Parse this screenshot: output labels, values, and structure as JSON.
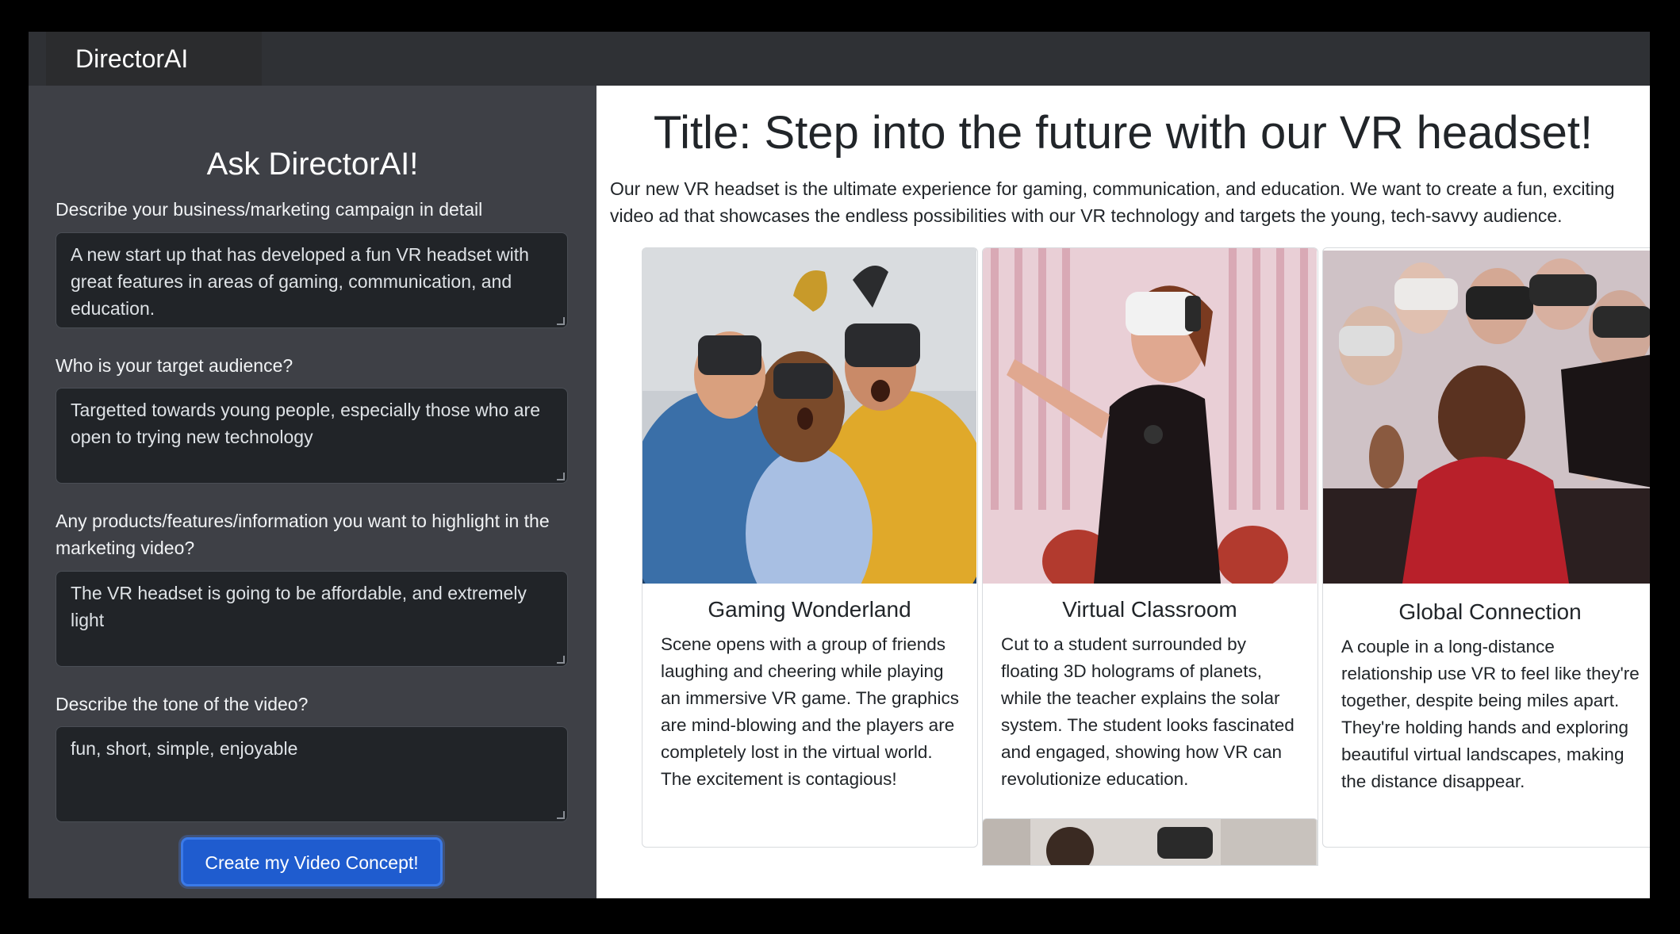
{
  "navbar": {
    "brand": "DirectorAI"
  },
  "sidebar": {
    "title": "Ask DirectorAI!",
    "fields": [
      {
        "label": "Describe your business/marketing campaign in detail",
        "value": "A new start up that has developed a fun VR headset with great features in areas of gaming, communication, and education."
      },
      {
        "label": "Who is your target audience?",
        "value": "Targetted towards young people, especially those who are open to trying new technology"
      },
      {
        "label": "Any products/features/information you want to highlight in the marketing video?",
        "value": "The VR headset is going to be affordable, and extremely light"
      },
      {
        "label": "Describe the tone of the video?",
        "value": "fun, short, simple, enjoyable"
      }
    ],
    "submit_label": "Create my Video Concept!"
  },
  "main": {
    "title": "Title: Step into the future with our VR headset!",
    "description": "Our new VR headset is the ultimate experience for gaming, communication, and education. We want to create a fun, exciting video ad that showcases the endless possibilities with our VR technology and targets the young, tech-savvy audience.",
    "cards": [
      {
        "title": "Gaming Wonderland",
        "text": "Scene opens with a group of friends laughing and cheering while playing an immersive VR game. The graphics are mind-blowing and the players are completely lost in the virtual world. The excitement is contagious!"
      },
      {
        "title": "Virtual Classroom",
        "text": "Cut to a student surrounded by floating 3D holograms of planets, while the teacher explains the solar system. The student looks fascinated and engaged, showing how VR can revolutionize education."
      },
      {
        "title": "Global Connection",
        "text": "A couple in a long-distance relationship use VR to feel like they're together, despite being miles apart. They're holding hands and exploring beautiful virtual landscapes, making the distance disappear."
      }
    ]
  }
}
